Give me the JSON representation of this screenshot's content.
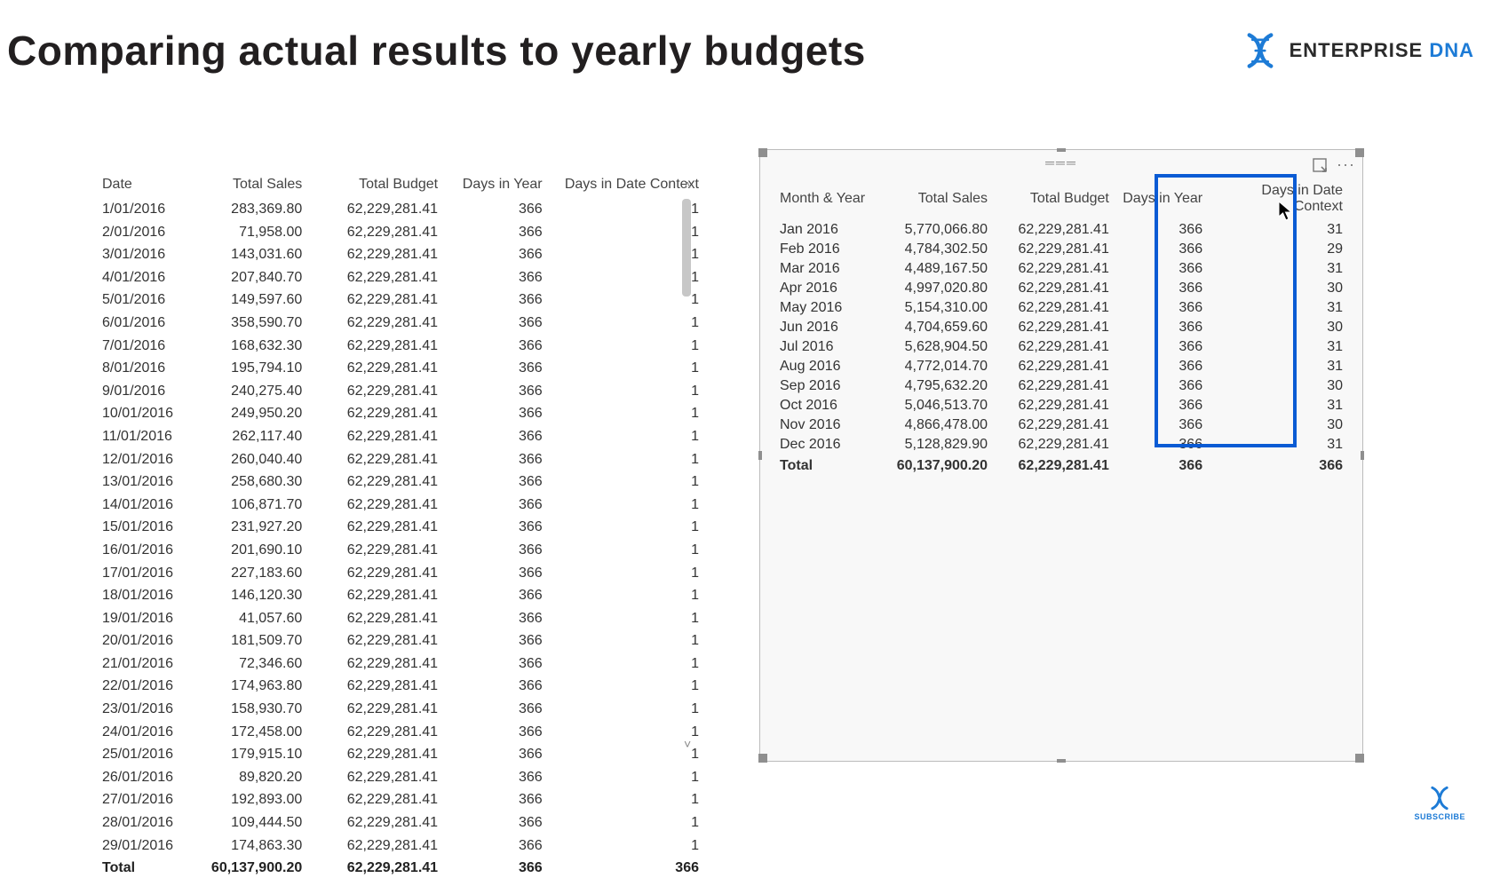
{
  "title": "Comparing actual results to yearly budgets",
  "brand": {
    "name": "ENTERPRISE",
    "suffix": "DNA"
  },
  "leftTable": {
    "headers": [
      "Date",
      "Total Sales",
      "Total Budget",
      "Days in Year",
      "Days in Date Context"
    ],
    "rows": [
      {
        "c0": "1/01/2016",
        "c1": "283,369.80",
        "c2": "62,229,281.41",
        "c3": "366",
        "c4": "1"
      },
      {
        "c0": "2/01/2016",
        "c1": "71,958.00",
        "c2": "62,229,281.41",
        "c3": "366",
        "c4": "1"
      },
      {
        "c0": "3/01/2016",
        "c1": "143,031.60",
        "c2": "62,229,281.41",
        "c3": "366",
        "c4": "1"
      },
      {
        "c0": "4/01/2016",
        "c1": "207,840.70",
        "c2": "62,229,281.41",
        "c3": "366",
        "c4": "1"
      },
      {
        "c0": "5/01/2016",
        "c1": "149,597.60",
        "c2": "62,229,281.41",
        "c3": "366",
        "c4": "1"
      },
      {
        "c0": "6/01/2016",
        "c1": "358,590.70",
        "c2": "62,229,281.41",
        "c3": "366",
        "c4": "1"
      },
      {
        "c0": "7/01/2016",
        "c1": "168,632.30",
        "c2": "62,229,281.41",
        "c3": "366",
        "c4": "1"
      },
      {
        "c0": "8/01/2016",
        "c1": "195,794.10",
        "c2": "62,229,281.41",
        "c3": "366",
        "c4": "1"
      },
      {
        "c0": "9/01/2016",
        "c1": "240,275.40",
        "c2": "62,229,281.41",
        "c3": "366",
        "c4": "1"
      },
      {
        "c0": "10/01/2016",
        "c1": "249,950.20",
        "c2": "62,229,281.41",
        "c3": "366",
        "c4": "1"
      },
      {
        "c0": "11/01/2016",
        "c1": "262,117.40",
        "c2": "62,229,281.41",
        "c3": "366",
        "c4": "1"
      },
      {
        "c0": "12/01/2016",
        "c1": "260,040.40",
        "c2": "62,229,281.41",
        "c3": "366",
        "c4": "1"
      },
      {
        "c0": "13/01/2016",
        "c1": "258,680.30",
        "c2": "62,229,281.41",
        "c3": "366",
        "c4": "1"
      },
      {
        "c0": "14/01/2016",
        "c1": "106,871.70",
        "c2": "62,229,281.41",
        "c3": "366",
        "c4": "1"
      },
      {
        "c0": "15/01/2016",
        "c1": "231,927.20",
        "c2": "62,229,281.41",
        "c3": "366",
        "c4": "1"
      },
      {
        "c0": "16/01/2016",
        "c1": "201,690.10",
        "c2": "62,229,281.41",
        "c3": "366",
        "c4": "1"
      },
      {
        "c0": "17/01/2016",
        "c1": "227,183.60",
        "c2": "62,229,281.41",
        "c3": "366",
        "c4": "1"
      },
      {
        "c0": "18/01/2016",
        "c1": "146,120.30",
        "c2": "62,229,281.41",
        "c3": "366",
        "c4": "1"
      },
      {
        "c0": "19/01/2016",
        "c1": "41,057.60",
        "c2": "62,229,281.41",
        "c3": "366",
        "c4": "1"
      },
      {
        "c0": "20/01/2016",
        "c1": "181,509.70",
        "c2": "62,229,281.41",
        "c3": "366",
        "c4": "1"
      },
      {
        "c0": "21/01/2016",
        "c1": "72,346.60",
        "c2": "62,229,281.41",
        "c3": "366",
        "c4": "1"
      },
      {
        "c0": "22/01/2016",
        "c1": "174,963.80",
        "c2": "62,229,281.41",
        "c3": "366",
        "c4": "1"
      },
      {
        "c0": "23/01/2016",
        "c1": "158,930.70",
        "c2": "62,229,281.41",
        "c3": "366",
        "c4": "1"
      },
      {
        "c0": "24/01/2016",
        "c1": "172,458.00",
        "c2": "62,229,281.41",
        "c3": "366",
        "c4": "1"
      },
      {
        "c0": "25/01/2016",
        "c1": "179,915.10",
        "c2": "62,229,281.41",
        "c3": "366",
        "c4": "1"
      },
      {
        "c0": "26/01/2016",
        "c1": "89,820.20",
        "c2": "62,229,281.41",
        "c3": "366",
        "c4": "1"
      },
      {
        "c0": "27/01/2016",
        "c1": "192,893.00",
        "c2": "62,229,281.41",
        "c3": "366",
        "c4": "1"
      },
      {
        "c0": "28/01/2016",
        "c1": "109,444.50",
        "c2": "62,229,281.41",
        "c3": "366",
        "c4": "1"
      },
      {
        "c0": "29/01/2016",
        "c1": "174,863.30",
        "c2": "62,229,281.41",
        "c3": "366",
        "c4": "1"
      }
    ],
    "total": {
      "c0": "Total",
      "c1": "60,137,900.20",
      "c2": "62,229,281.41",
      "c3": "366",
      "c4": "366"
    }
  },
  "rightTable": {
    "headers": [
      "Month & Year",
      "Total Sales",
      "Total Budget",
      "Days in Year",
      "Days in Date Context"
    ],
    "rows": [
      {
        "c0": "Jan 2016",
        "c1": "5,770,066.80",
        "c2": "62,229,281.41",
        "c3": "366",
        "c4": "31"
      },
      {
        "c0": "Feb 2016",
        "c1": "4,784,302.50",
        "c2": "62,229,281.41",
        "c3": "366",
        "c4": "29"
      },
      {
        "c0": "Mar 2016",
        "c1": "4,489,167.50",
        "c2": "62,229,281.41",
        "c3": "366",
        "c4": "31"
      },
      {
        "c0": "Apr 2016",
        "c1": "4,997,020.80",
        "c2": "62,229,281.41",
        "c3": "366",
        "c4": "30"
      },
      {
        "c0": "May 2016",
        "c1": "5,154,310.00",
        "c2": "62,229,281.41",
        "c3": "366",
        "c4": "31"
      },
      {
        "c0": "Jun 2016",
        "c1": "4,704,659.60",
        "c2": "62,229,281.41",
        "c3": "366",
        "c4": "30"
      },
      {
        "c0": "Jul 2016",
        "c1": "5,628,904.50",
        "c2": "62,229,281.41",
        "c3": "366",
        "c4": "31"
      },
      {
        "c0": "Aug 2016",
        "c1": "4,772,014.70",
        "c2": "62,229,281.41",
        "c3": "366",
        "c4": "31"
      },
      {
        "c0": "Sep 2016",
        "c1": "4,795,632.20",
        "c2": "62,229,281.41",
        "c3": "366",
        "c4": "30"
      },
      {
        "c0": "Oct 2016",
        "c1": "5,046,513.70",
        "c2": "62,229,281.41",
        "c3": "366",
        "c4": "31"
      },
      {
        "c0": "Nov 2016",
        "c1": "4,866,478.00",
        "c2": "62,229,281.41",
        "c3": "366",
        "c4": "30"
      },
      {
        "c0": "Dec 2016",
        "c1": "5,128,829.90",
        "c2": "62,229,281.41",
        "c3": "366",
        "c4": "31"
      }
    ],
    "total": {
      "c0": "Total",
      "c1": "60,137,900.20",
      "c2": "62,229,281.41",
      "c3": "366",
      "c4": "366"
    }
  },
  "subscribe": "SUBSCRIBE"
}
